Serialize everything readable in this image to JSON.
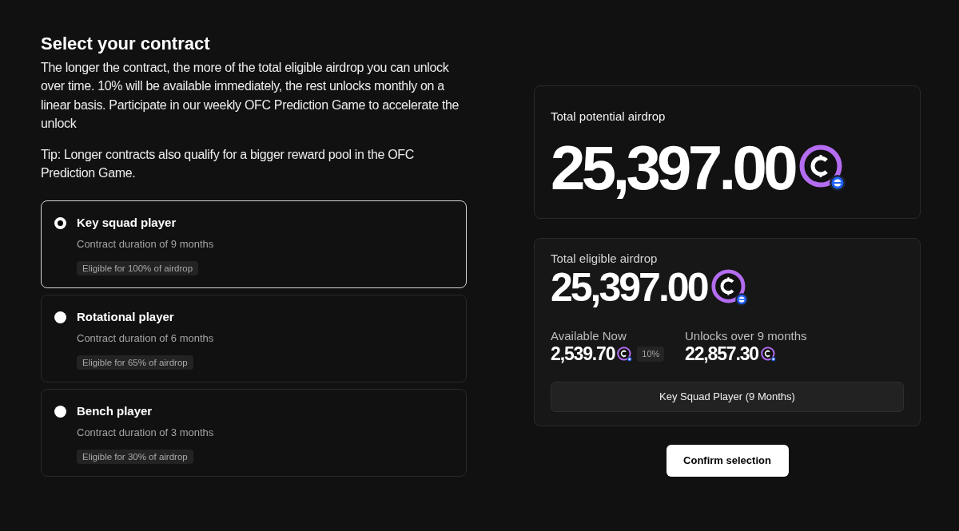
{
  "intro": {
    "title": "Select your contract",
    "description": "The longer the contract, the more of the total eligible airdrop you can unlock over time. 10% will be available immediately, the rest unlocks monthly on a linear basis. Participate in our weekly OFC Prediction Game to accelerate the unlock",
    "tip": "Tip: Longer contracts also qualify for a bigger reward pool in the OFC Prediction Game."
  },
  "contracts": [
    {
      "title": "Key squad player",
      "duration": "Contract duration of 9 months",
      "eligibility": "Eligible for 100% of airdrop",
      "selected": true
    },
    {
      "title": "Rotational player",
      "duration": "Contract duration of 6 months",
      "eligibility": "Eligible for 65% of airdrop",
      "selected": false
    },
    {
      "title": "Bench player",
      "duration": "Contract duration of 3 months",
      "eligibility": "Eligible for 30% of airdrop",
      "selected": false
    }
  ],
  "potential": {
    "label": "Total potential airdrop",
    "amount": "25,397.00"
  },
  "eligible": {
    "label": "Total eligible airdrop",
    "amount": "25,397.00",
    "available": {
      "label": "Available Now",
      "amount": "2,539.70",
      "percent": "10%"
    },
    "unlocks": {
      "label": "Unlocks over 9 months",
      "amount": "22,857.30"
    },
    "selection": "Key Squad Player (9 Months)"
  },
  "confirm_button": "Confirm selection"
}
